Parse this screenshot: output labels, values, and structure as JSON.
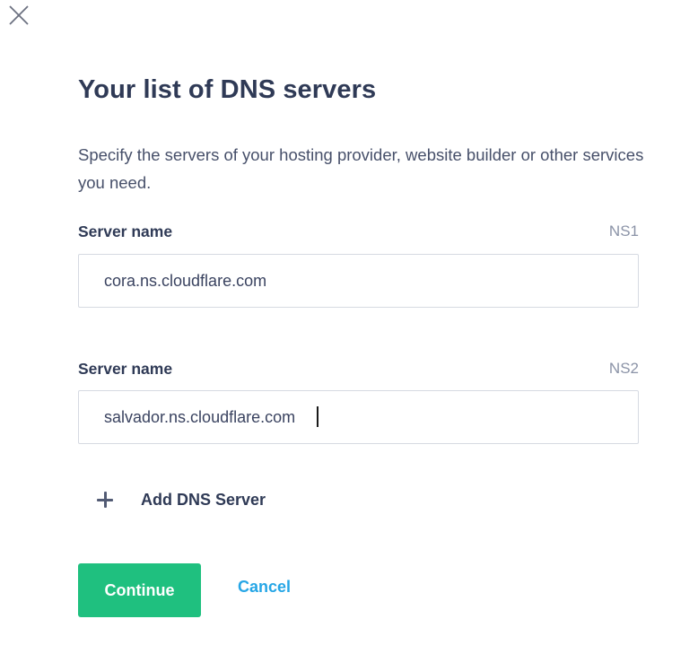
{
  "dialog": {
    "close_icon": "close-icon",
    "title": "Your list of DNS servers",
    "description": "Specify the servers of your hosting provider, website builder or other services you need.",
    "fields": [
      {
        "label": "Server name",
        "tag": "NS1",
        "value": "cora.ns.cloudflare.com"
      },
      {
        "label": "Server name",
        "tag": "NS2",
        "value": "salvador.ns.cloudflare.com"
      }
    ],
    "add_server": {
      "icon": "plus-icon",
      "label": "Add DNS Server"
    },
    "actions": {
      "continue_label": "Continue",
      "cancel_label": "Cancel"
    }
  },
  "colors": {
    "primary_button": "#1fc07f",
    "link": "#26a6e6",
    "heading": "#2f3a56",
    "muted": "#8b93a7",
    "border": "#d6dae2"
  }
}
